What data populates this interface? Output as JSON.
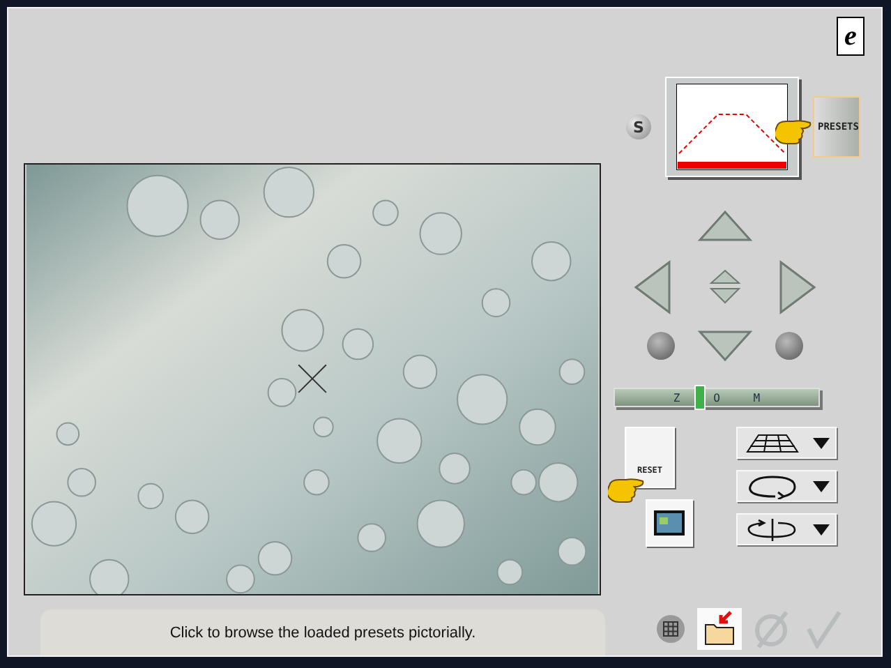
{
  "logo": "e",
  "presets": {
    "selector": "S",
    "button": "PRESETS"
  },
  "zoom": {
    "labels": [
      "Z",
      "O",
      "M"
    ],
    "level": 0.41
  },
  "reset": {
    "label": "RESET"
  },
  "dropdowns": [
    {
      "kind": "perspective"
    },
    {
      "kind": "rotate"
    },
    {
      "kind": "flip"
    }
  ],
  "actions": [
    {
      "kind": "grid"
    },
    {
      "kind": "open"
    },
    {
      "kind": "cancel"
    },
    {
      "kind": "ok"
    }
  ],
  "status_bar": {
    "text": "Click to browse the loaded presets pictorially."
  }
}
